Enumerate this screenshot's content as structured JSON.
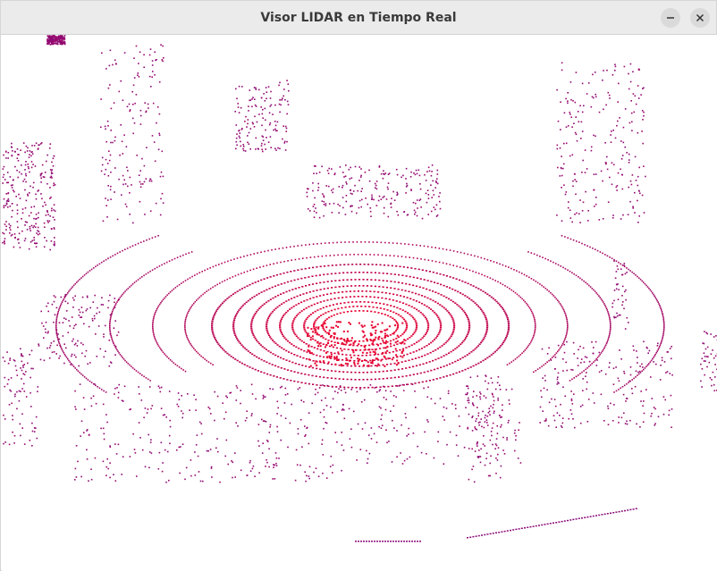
{
  "window": {
    "title": "Visor LIDAR en Tiempo Real",
    "controls": [
      {
        "name": "minimize",
        "icon": "minimize-icon"
      },
      {
        "name": "close",
        "icon": "close-icon"
      }
    ]
  },
  "viewer": {
    "content": "lidar-point-cloud",
    "colors": {
      "near": "#e8002e",
      "far": "#8a0a78",
      "background": "#ffffff"
    }
  }
}
